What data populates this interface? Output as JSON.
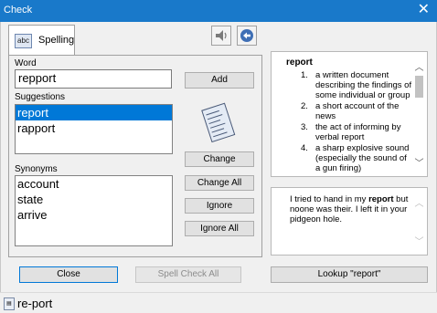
{
  "window": {
    "title": "Check",
    "close_glyph": "✕"
  },
  "tab": {
    "label": "Spelling",
    "icon_text": "abc"
  },
  "toolbar": {
    "speak_icon": "speaker-icon",
    "back_icon": "back-arrow-icon"
  },
  "word": {
    "label": "Word",
    "value": "repport"
  },
  "suggestions": {
    "label": "Suggestions",
    "items": [
      "report",
      "rapport"
    ],
    "selected": "report"
  },
  "synonyms": {
    "label": "Synonyms",
    "items": [
      "account",
      "state",
      "arrive"
    ]
  },
  "buttons": {
    "add": "Add",
    "change": "Change",
    "change_all": "Change All",
    "ignore": "Ignore",
    "ignore_all": "Ignore All",
    "close": "Close",
    "spell_check_all": "Spell Check All",
    "lookup": "Lookup \"report\""
  },
  "definition": {
    "word": "report",
    "items": [
      {
        "num": "1.",
        "text": "a written document describing the findings of some individual or group"
      },
      {
        "num": "2.",
        "text": "a short account of the news"
      },
      {
        "num": "3.",
        "text": "the act of informing by verbal report"
      },
      {
        "num": "4.",
        "text": "a sharp explosive sound (especially the sound of a gun firing)"
      }
    ]
  },
  "sample": {
    "before": "I tried to hand in my ",
    "highlight": "report",
    "after": " but noone was their. I left it in your pidgeon hole."
  },
  "status": {
    "text": "re-port"
  },
  "colors": {
    "titlebar": "#1979ca",
    "selection": "#0078d7"
  }
}
